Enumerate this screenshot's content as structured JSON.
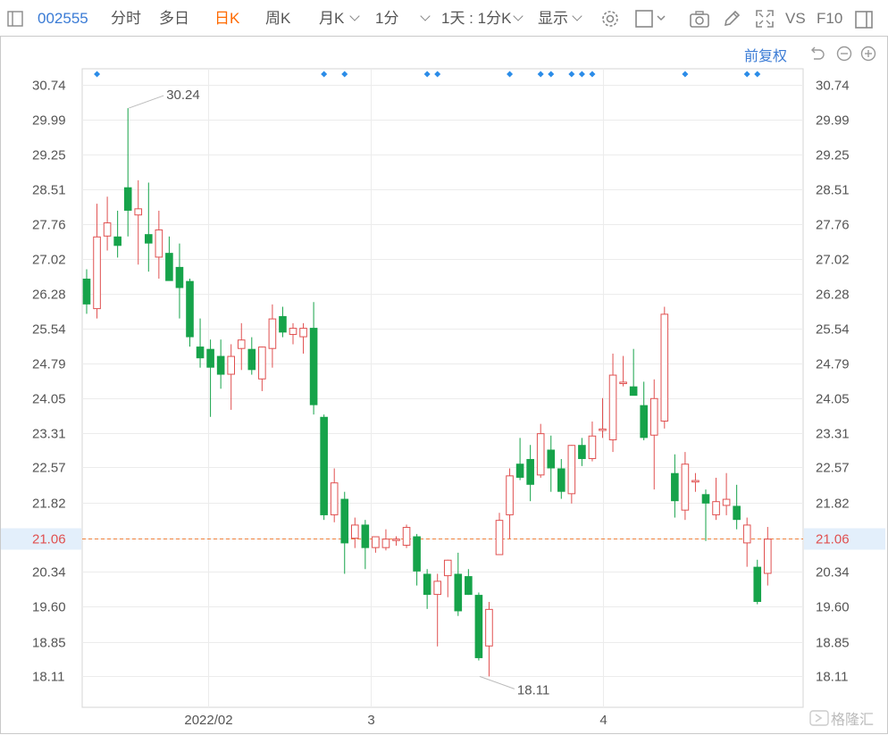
{
  "toolbar": {
    "code": "002555",
    "tabs": [
      "分时",
      "多日",
      "日K",
      "周K",
      "月K"
    ],
    "active_tab": "日K",
    "period": "1分",
    "range": "1天 : 1分K",
    "display": "显示",
    "vs": "VS",
    "f10": "F10"
  },
  "adjust_label": "前复权",
  "watermark": "格隆汇",
  "colors": {
    "up": "#e05050",
    "down": "#16a34a",
    "accent": "#3a7bd5",
    "price_line": "#f0803c"
  },
  "chart_data": {
    "type": "candlestick",
    "y_ticks": [
      30.74,
      29.99,
      29.25,
      28.51,
      27.76,
      27.02,
      26.28,
      25.54,
      24.79,
      24.05,
      23.31,
      22.57,
      21.82,
      21.06,
      20.34,
      19.6,
      18.85,
      18.11
    ],
    "ylim": [
      17.45,
      31.08
    ],
    "x_labels": [
      {
        "label": "2022/02",
        "index": 11.8
      },
      {
        "label": "3",
        "index": 27.5
      },
      {
        "label": "4",
        "index": 50
      }
    ],
    "current_price": 21.06,
    "annotations": [
      {
        "text": "30.24",
        "index": 4,
        "value": 30.24
      },
      {
        "text": "18.11",
        "index": 38,
        "value": 18.11
      }
    ],
    "event_markers": [
      1,
      23,
      25,
      33,
      34,
      41,
      44,
      45,
      47,
      48,
      49,
      58,
      64,
      65
    ],
    "candles": [
      {
        "o": 26.6,
        "h": 26.8,
        "l": 25.85,
        "c": 26.05
      },
      {
        "o": 25.95,
        "h": 28.2,
        "l": 25.75,
        "c": 27.5
      },
      {
        "o": 27.5,
        "h": 28.35,
        "l": 27.2,
        "c": 27.8
      },
      {
        "o": 27.5,
        "h": 28.05,
        "l": 27.05,
        "c": 27.3
      },
      {
        "o": 28.55,
        "h": 30.24,
        "l": 27.5,
        "c": 28.05
      },
      {
        "o": 27.95,
        "h": 28.7,
        "l": 26.9,
        "c": 28.1
      },
      {
        "o": 27.55,
        "h": 28.65,
        "l": 26.75,
        "c": 27.35
      },
      {
        "o": 27.05,
        "h": 28.05,
        "l": 26.6,
        "c": 27.65
      },
      {
        "o": 27.15,
        "h": 27.5,
        "l": 26.6,
        "c": 26.55
      },
      {
        "o": 26.85,
        "h": 27.35,
        "l": 25.75,
        "c": 26.4
      },
      {
        "o": 26.55,
        "h": 26.6,
        "l": 25.15,
        "c": 25.35
      },
      {
        "o": 25.15,
        "h": 25.75,
        "l": 24.7,
        "c": 24.9
      },
      {
        "o": 25.1,
        "h": 25.3,
        "l": 23.65,
        "c": 24.7
      },
      {
        "o": 24.95,
        "h": 25.3,
        "l": 24.25,
        "c": 24.55
      },
      {
        "o": 24.55,
        "h": 25.2,
        "l": 23.8,
        "c": 24.95
      },
      {
        "o": 25.1,
        "h": 25.65,
        "l": 24.65,
        "c": 25.3
      },
      {
        "o": 25.1,
        "h": 25.35,
        "l": 24.55,
        "c": 24.65
      },
      {
        "o": 24.45,
        "h": 25.15,
        "l": 24.2,
        "c": 25.15
      },
      {
        "o": 25.1,
        "h": 26.05,
        "l": 24.7,
        "c": 25.75
      },
      {
        "o": 25.8,
        "h": 26.0,
        "l": 25.35,
        "c": 25.45
      },
      {
        "o": 25.4,
        "h": 25.65,
        "l": 25.2,
        "c": 25.55
      },
      {
        "o": 25.35,
        "h": 25.65,
        "l": 25.0,
        "c": 25.55
      },
      {
        "o": 25.55,
        "h": 26.1,
        "l": 23.7,
        "c": 23.9
      },
      {
        "o": 23.65,
        "h": 23.7,
        "l": 21.45,
        "c": 21.55
      },
      {
        "o": 21.55,
        "h": 22.55,
        "l": 21.4,
        "c": 22.25
      },
      {
        "o": 21.9,
        "h": 22.05,
        "l": 20.3,
        "c": 20.95
      },
      {
        "o": 21.05,
        "h": 21.5,
        "l": 20.85,
        "c": 21.35
      },
      {
        "o": 21.35,
        "h": 21.45,
        "l": 20.4,
        "c": 20.85
      },
      {
        "o": 20.85,
        "h": 21.05,
        "l": 20.75,
        "c": 21.1
      },
      {
        "o": 20.85,
        "h": 21.25,
        "l": 20.8,
        "c": 21.05
      },
      {
        "o": 21.0,
        "h": 21.1,
        "l": 20.9,
        "c": 21.05
      },
      {
        "o": 20.9,
        "h": 21.35,
        "l": 20.85,
        "c": 21.3
      },
      {
        "o": 21.1,
        "h": 21.15,
        "l": 20.05,
        "c": 20.35
      },
      {
        "o": 20.3,
        "h": 20.4,
        "l": 19.55,
        "c": 19.85
      },
      {
        "o": 19.85,
        "h": 20.3,
        "l": 18.75,
        "c": 20.15
      },
      {
        "o": 20.25,
        "h": 20.6,
        "l": 19.8,
        "c": 20.6
      },
      {
        "o": 20.3,
        "h": 20.75,
        "l": 19.4,
        "c": 19.5
      },
      {
        "o": 20.25,
        "h": 20.4,
        "l": 19.85,
        "c": 19.85
      },
      {
        "o": 19.85,
        "h": 19.9,
        "l": 18.45,
        "c": 18.5
      },
      {
        "o": 18.75,
        "h": 19.7,
        "l": 18.11,
        "c": 19.55
      },
      {
        "o": 20.7,
        "h": 21.6,
        "l": 20.7,
        "c": 21.45
      },
      {
        "o": 21.55,
        "h": 22.55,
        "l": 21.05,
        "c": 22.4
      },
      {
        "o": 22.65,
        "h": 23.2,
        "l": 22.3,
        "c": 22.35
      },
      {
        "o": 22.75,
        "h": 23.05,
        "l": 21.85,
        "c": 22.2
      },
      {
        "o": 22.4,
        "h": 23.5,
        "l": 22.35,
        "c": 23.3
      },
      {
        "o": 22.95,
        "h": 23.25,
        "l": 22.05,
        "c": 22.55
      },
      {
        "o": 22.55,
        "h": 22.75,
        "l": 21.9,
        "c": 22.05
      },
      {
        "o": 22.0,
        "h": 23.05,
        "l": 21.8,
        "c": 23.05
      },
      {
        "o": 23.05,
        "h": 23.2,
        "l": 22.6,
        "c": 22.75
      },
      {
        "o": 22.75,
        "h": 23.55,
        "l": 22.7,
        "c": 23.25
      },
      {
        "o": 23.35,
        "h": 24.05,
        "l": 23.2,
        "c": 23.4
      },
      {
        "o": 23.15,
        "h": 25.0,
        "l": 22.9,
        "c": 24.55
      },
      {
        "o": 24.35,
        "h": 24.95,
        "l": 24.3,
        "c": 24.4
      },
      {
        "o": 24.3,
        "h": 25.1,
        "l": 24.2,
        "c": 24.1
      },
      {
        "o": 23.9,
        "h": 24.4,
        "l": 23.15,
        "c": 23.2
      },
      {
        "o": 23.25,
        "h": 24.45,
        "l": 22.1,
        "c": 24.05
      },
      {
        "o": 23.55,
        "h": 26.0,
        "l": 23.4,
        "c": 25.85
      },
      {
        "o": 22.45,
        "h": 22.85,
        "l": 21.5,
        "c": 21.85
      },
      {
        "o": 21.65,
        "h": 22.9,
        "l": 21.45,
        "c": 22.65
      },
      {
        "o": 22.25,
        "h": 22.45,
        "l": 22.05,
        "c": 22.3
      },
      {
        "o": 22.0,
        "h": 22.1,
        "l": 21.0,
        "c": 21.8
      },
      {
        "o": 21.55,
        "h": 22.35,
        "l": 21.45,
        "c": 21.85
      },
      {
        "o": 21.75,
        "h": 22.45,
        "l": 21.55,
        "c": 21.9
      },
      {
        "o": 21.75,
        "h": 22.2,
        "l": 21.25,
        "c": 21.45
      },
      {
        "o": 20.95,
        "h": 21.5,
        "l": 20.45,
        "c": 21.35
      },
      {
        "o": 20.45,
        "h": 20.6,
        "l": 19.65,
        "c": 19.7
      },
      {
        "o": 20.3,
        "h": 21.3,
        "l": 20.05,
        "c": 21.05
      }
    ]
  }
}
